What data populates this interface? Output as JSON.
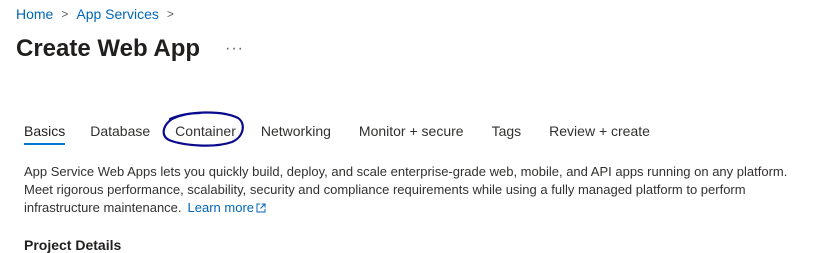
{
  "breadcrumb": {
    "items": [
      "Home",
      "App Services"
    ],
    "separator": ">"
  },
  "page": {
    "title": "Create Web App",
    "more_icon": "ellipsis-icon"
  },
  "tabs": [
    {
      "label": "Basics",
      "active": true
    },
    {
      "label": "Database",
      "active": false
    },
    {
      "label": "Container",
      "active": false,
      "annotated": true
    },
    {
      "label": "Networking",
      "active": false
    },
    {
      "label": "Monitor + secure",
      "active": false
    },
    {
      "label": "Tags",
      "active": false
    },
    {
      "label": "Review + create",
      "active": false
    }
  ],
  "description": {
    "text": "App Service Web Apps lets you quickly build, deploy, and scale enterprise-grade web, mobile, and API apps running on any platform. Meet rigorous performance, scalability, security and compliance requirements while using a fully managed platform to perform infrastructure maintenance.",
    "link_label": "Learn more",
    "link_icon": "external-link-icon"
  },
  "sections": {
    "project_details": "Project Details"
  },
  "colors": {
    "link": "#0066b8",
    "accent": "#0078d4",
    "annotation": "#0a0a8c"
  }
}
